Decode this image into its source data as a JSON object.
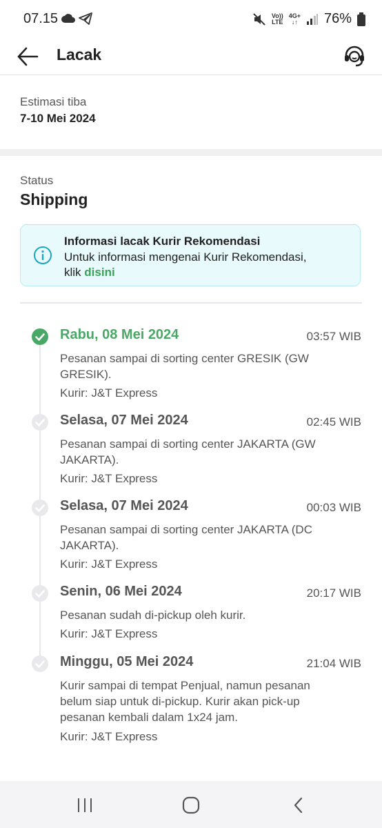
{
  "status_bar": {
    "time": "07.15",
    "battery": "76%",
    "network_top": "Vo))",
    "network_bottom": "LTE",
    "net_gen": "4G+",
    "icons": [
      "cloud-icon",
      "telegram-icon",
      "mute-icon",
      "signal-icon",
      "battery-icon"
    ]
  },
  "app_bar": {
    "title": "Lacak",
    "back_icon": "arrow-left-icon",
    "help_icon": "headset-icon"
  },
  "eta": {
    "label": "Estimasi tiba",
    "value": "7-10 Mei 2024"
  },
  "status": {
    "label": "Status",
    "value": "Shipping"
  },
  "info_box": {
    "title": "Informasi lacak Kurir Rekomendasi",
    "body": "Untuk informasi mengenai Kurir Rekomendasi,",
    "body_prefix": "klik ",
    "link": "disini",
    "accent": "#3aa35a"
  },
  "timeline": [
    {
      "date": "Rabu, 08 Mei 2024",
      "time": "03:57 WIB",
      "desc": "Pesanan sampai di sorting center GRESIK (GW GRESIK).",
      "courier": "Kurir: J&T Express",
      "active": true
    },
    {
      "date": "Selasa, 07 Mei 2024",
      "time": "02:45 WIB",
      "desc": "Pesanan sampai di sorting center JAKARTA (GW JAKARTA).",
      "courier": "Kurir: J&T Express",
      "active": false
    },
    {
      "date": "Selasa, 07 Mei 2024",
      "time": "00:03 WIB",
      "desc": "Pesanan sampai di sorting center JAKARTA (DC JAKARTA).",
      "courier": "Kurir: J&T Express",
      "active": false
    },
    {
      "date": "Senin, 06 Mei 2024",
      "time": "20:17 WIB",
      "desc": "Pesanan sudah di-pickup oleh kurir.",
      "courier": "Kurir: J&T Express",
      "active": false
    },
    {
      "date": "Minggu, 05 Mei 2024",
      "time": "21:04 WIB",
      "desc": "Kurir sampai di tempat Penjual, namun pesanan belum siap untuk di-pickup. Kurir akan pick-up pesanan kembali dalam 1x24 jam.",
      "courier": "Kurir: J&T Express",
      "active": false
    }
  ],
  "colors": {
    "active_green": "#4aa866",
    "inactive_dot": "#e3e3e6"
  },
  "nav_bar": {
    "icons": [
      "recent-apps-icon",
      "home-icon",
      "back-nav-icon"
    ]
  }
}
